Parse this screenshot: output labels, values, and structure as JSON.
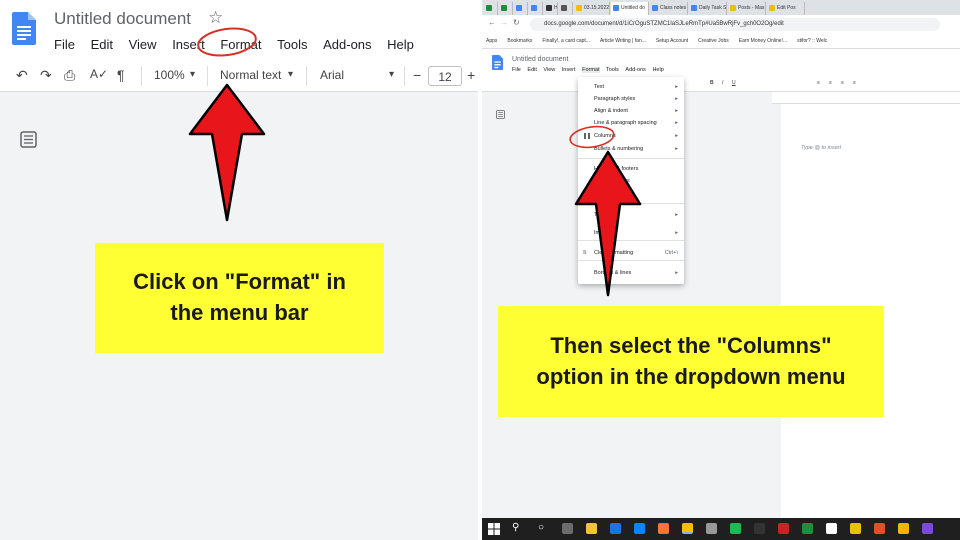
{
  "left": {
    "doc_title": "Untitled document",
    "star": "☆",
    "menu": [
      "File",
      "Edit",
      "View",
      "Insert",
      "Format",
      "Tools",
      "Add-ons",
      "Help"
    ],
    "toolbar": {
      "undo": "↶",
      "redo": "↷",
      "print": "⎙",
      "spell": "A✓",
      "paint": "¶",
      "zoom": "100%",
      "style": "Normal text",
      "font": "Arial",
      "minus": "−",
      "size": "12",
      "plus": "+",
      "dropdown": "▾"
    },
    "callout": "Click on \"Format\" in\nthe menu bar"
  },
  "right": {
    "tabs": [
      {
        "label": "",
        "color": "#1e8e3e"
      },
      {
        "label": "",
        "color": "#1e8e3e"
      },
      {
        "label": "",
        "color": "#4285f4"
      },
      {
        "label": "",
        "color": "#4285f4"
      },
      {
        "label": "H",
        "color": "#333333"
      },
      {
        "label": "",
        "color": "#555555"
      },
      {
        "label": "03.15.2022",
        "color": "#fbbc04"
      },
      {
        "label": "Untitled do",
        "color": "#4285f4"
      },
      {
        "label": "Class notes",
        "color": "#4285f4"
      },
      {
        "label": "Daily Task S",
        "color": "#4285f4"
      },
      {
        "label": "Posts - Mas",
        "color": "#e8c200"
      },
      {
        "label": "Edit Pos",
        "color": "#e8c200"
      }
    ],
    "url": "docs.google.com/document/d/1iCrOguSTZMC1laSJLeRmTp#Ua5BwRjFv_gch0O2Og/edit",
    "bookmarks": [
      "Apps",
      "Bookmarks",
      "Finally!, a card capt...",
      "Article Writing | fan...",
      "Setup Account",
      "Creative Jobs",
      "Earn Money Online!...",
      "stifor? :: Welc"
    ],
    "doc_title": "Untitled document",
    "menu": [
      "File",
      "Edit",
      "View",
      "Insert",
      "Format",
      "Tools",
      "Add-ons",
      "Help"
    ],
    "dropdown_items": [
      {
        "label": "Text",
        "arrow": "▸"
      },
      {
        "label": "Paragraph styles",
        "arrow": "▸"
      },
      {
        "label": "Align & indent",
        "arrow": "▸"
      },
      {
        "label": "Line & paragraph spacing",
        "arrow": "▸"
      },
      {
        "label": "Columns",
        "arrow": "▸"
      },
      {
        "label": "Bullets & numbering",
        "arrow": "▸"
      },
      {
        "label": "Headers & footers",
        "arrow": ""
      },
      {
        "label": "Page numbers",
        "arrow": ""
      },
      {
        "label": "Page orientation",
        "arrow": ""
      },
      {
        "label": "Table",
        "arrow": "▸"
      },
      {
        "label": "Image",
        "arrow": "▸"
      },
      {
        "label": "Clear formatting",
        "shortcut": "Ctrl+\\"
      },
      {
        "label": "Borders & lines",
        "arrow": "▸"
      }
    ],
    "type_hint": "Type @ to insert",
    "callout": "Then select the \"Columns\"\noption in the dropdown menu"
  },
  "colors": {
    "callout_bg": "#ffff33",
    "arrow_red": "#e8161b",
    "circle_red": "#d93025",
    "docs_blue": "#4285f4"
  }
}
